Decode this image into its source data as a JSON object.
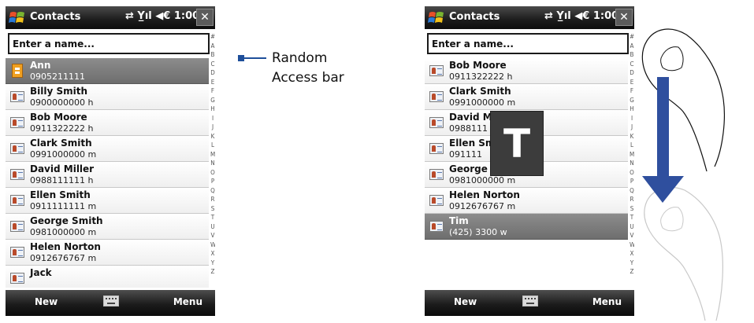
{
  "left_phone": {
    "titlebar": {
      "title": "Contacts",
      "status": "⇄ Y̲ıl ◀€ 1:00",
      "close": "✕"
    },
    "search": {
      "placeholder": "Enter a name..."
    },
    "contacts": [
      {
        "name": "Ann",
        "phone": "0905211111",
        "icon": "sim-contact-icon",
        "selected": true
      },
      {
        "name": "Billy Smith",
        "phone": "0900000000  h",
        "icon": "contact-card-icon"
      },
      {
        "name": "Bob Moore",
        "phone": "0911322222  h",
        "icon": "contact-card-icon"
      },
      {
        "name": "Clark Smith",
        "phone": "0991000000  m",
        "icon": "contact-card-icon"
      },
      {
        "name": "David Miller",
        "phone": "0988111111  h",
        "icon": "contact-card-icon"
      },
      {
        "name": "Ellen Smith",
        "phone": "0911111111  m",
        "icon": "contact-card-icon"
      },
      {
        "name": "George Smith",
        "phone": "0981000000  m",
        "icon": "contact-card-icon"
      },
      {
        "name": "Helen Norton",
        "phone": "0912676767  m",
        "icon": "contact-card-icon"
      },
      {
        "name": "Jack",
        "phone": "",
        "icon": "contact-card-icon"
      }
    ],
    "alphabet": [
      "#",
      "A",
      "B",
      "C",
      "D",
      "E",
      "F",
      "G",
      "H",
      "I",
      "J",
      "K",
      "L",
      "M",
      "N",
      "O",
      "P",
      "Q",
      "R",
      "S",
      "T",
      "U",
      "V",
      "W",
      "X",
      "Y",
      "Z"
    ],
    "menubar": {
      "left": "New",
      "right": "Menu"
    }
  },
  "right_phone": {
    "titlebar": {
      "title": "Contacts",
      "status": "⇄ Y̲ıl ◀€ 1:00",
      "close": "✕"
    },
    "search": {
      "placeholder": "Enter a name..."
    },
    "contacts": [
      {
        "name": "Bob Moore",
        "phone": "0911322222  h"
      },
      {
        "name": "Clark Smith",
        "phone": "0991000000  m"
      },
      {
        "name": "David M",
        "phone": "0988111"
      },
      {
        "name": "Ellen Sm",
        "phone": "091111"
      },
      {
        "name": "George",
        "phone": "0981000000  m"
      },
      {
        "name": "Helen Norton",
        "phone": "0912676767  m"
      },
      {
        "name": "Tim",
        "phone": "(425) 3300  w",
        "selected": true
      }
    ],
    "popup_letter": "T",
    "alphabet": [
      "#",
      "A",
      "B",
      "C",
      "D",
      "E",
      "F",
      "G",
      "H",
      "I",
      "J",
      "K",
      "L",
      "M",
      "N",
      "O",
      "P",
      "Q",
      "R",
      "S",
      "T",
      "U",
      "V",
      "W",
      "X",
      "Y",
      "Z"
    ],
    "menubar": {
      "left": "New",
      "right": "Menu"
    }
  },
  "callout": {
    "line1": "Random",
    "line2": "Access bar"
  },
  "colors": {
    "callout": "#1e4f9a",
    "arrow": "#2f4f9e",
    "selected_row": "#7a7a7a"
  }
}
